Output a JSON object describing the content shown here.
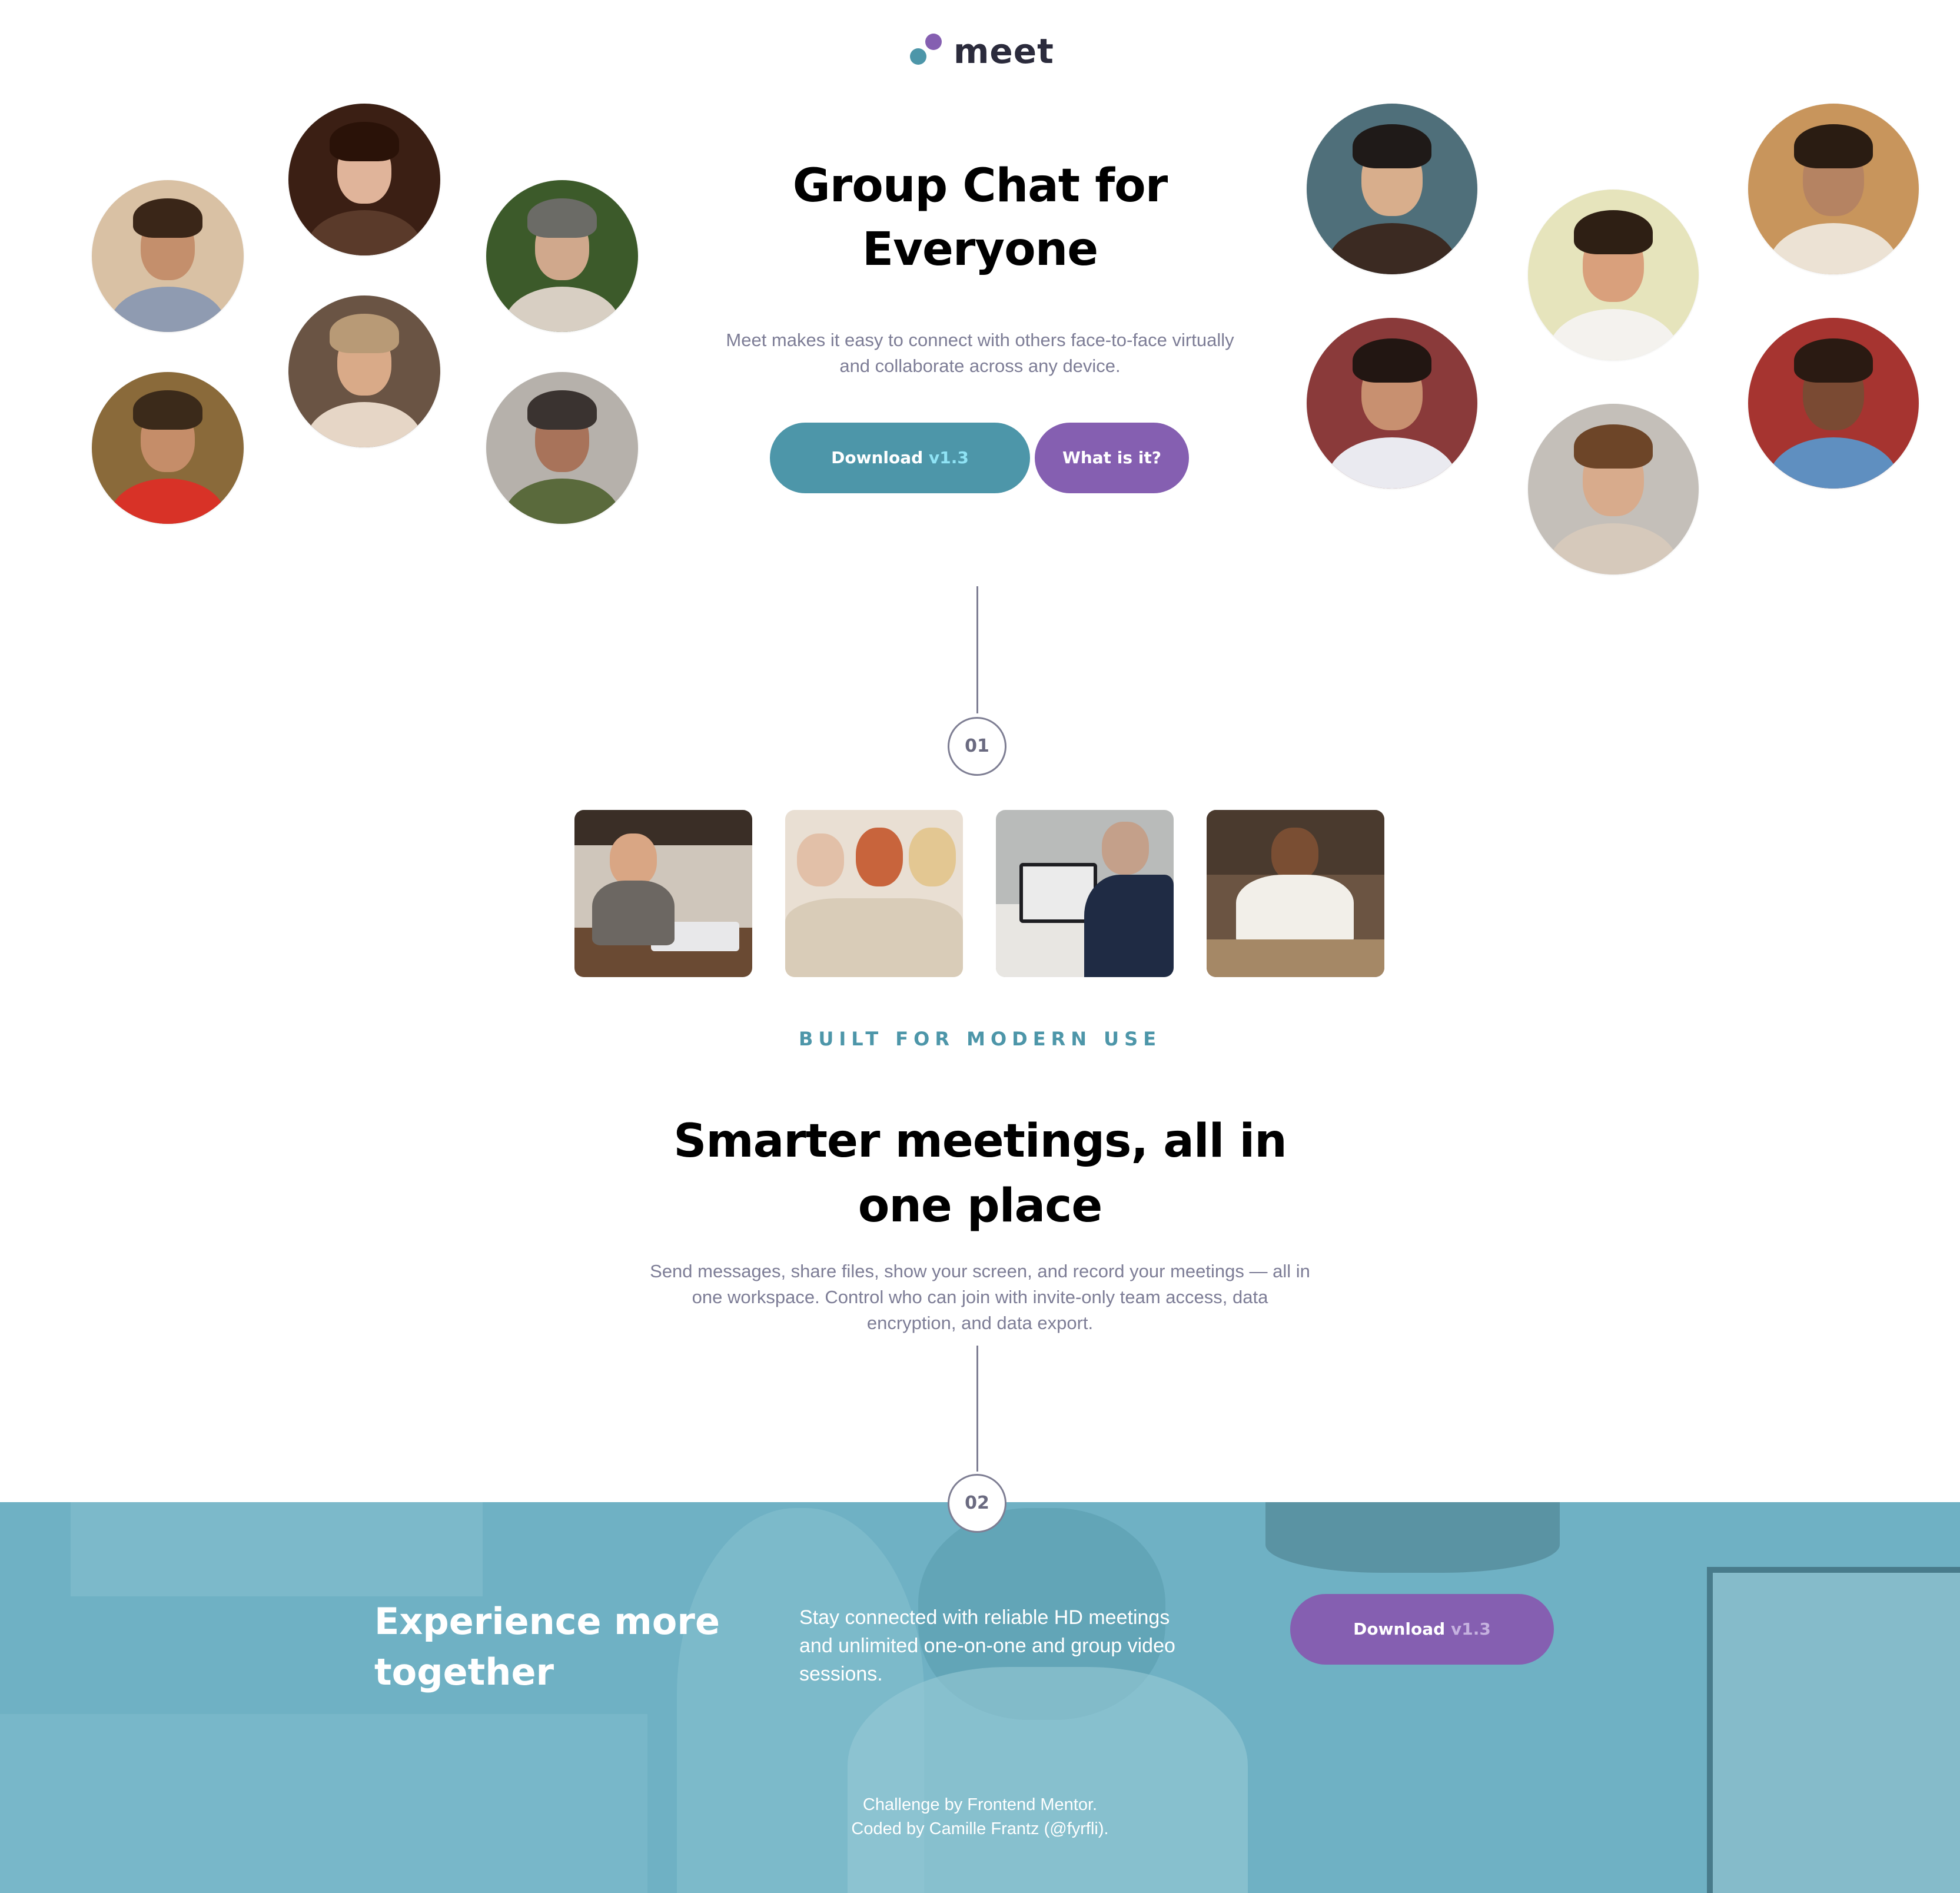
{
  "brand": {
    "name": "meet",
    "colors": {
      "teal": "#4d96a9",
      "purple": "#855fb1",
      "dark": "#2b2b3c",
      "grey_text": "#7d7d96"
    }
  },
  "hero": {
    "title_line1": "Group Chat for",
    "title_line2": "Everyone",
    "desc_line1": "Meet makes it easy to connect with others face-to-face virtually",
    "desc_line2": "and collaborate across any device.",
    "download_label": "Download",
    "download_version": "v1.3",
    "what_label": "What is it?"
  },
  "avatars_left": [
    "person-avatar",
    "person-avatar",
    "person-avatar",
    "person-avatar",
    "person-avatar",
    "person-avatar"
  ],
  "avatars_right": [
    "person-avatar",
    "person-avatar",
    "person-avatar",
    "person-avatar",
    "person-avatar",
    "person-avatar"
  ],
  "steps": {
    "one": "01",
    "two": "02"
  },
  "photos": [
    "woman-laptop-kitchen-photo",
    "women-phone-photo",
    "video-call-laptop-photo",
    "man-phone-photo"
  ],
  "section2": {
    "eyebrow": "BUILT FOR MODERN USE",
    "title_line1": "Smarter meetings, all in",
    "title_line2": "one place",
    "desc_line1": "Send messages, share files, show your screen, and record your meetings — all in",
    "desc_line2": "one workspace. Control who can join with invite-only team access, data",
    "desc_line3": "encryption, and data export."
  },
  "footer_band": {
    "title_line1": "Experience more",
    "title_line2": "together",
    "desc_line1": "Stay connected with reliable HD meetings",
    "desc_line2": "and unlimited one-on-one and group video",
    "desc_line3": "sessions.",
    "download_label": "Download",
    "download_version": "v1.3",
    "credit_line1": "Challenge by Frontend Mentor.",
    "credit_line2": "Coded by Camille Frantz (@fyrfli)."
  }
}
